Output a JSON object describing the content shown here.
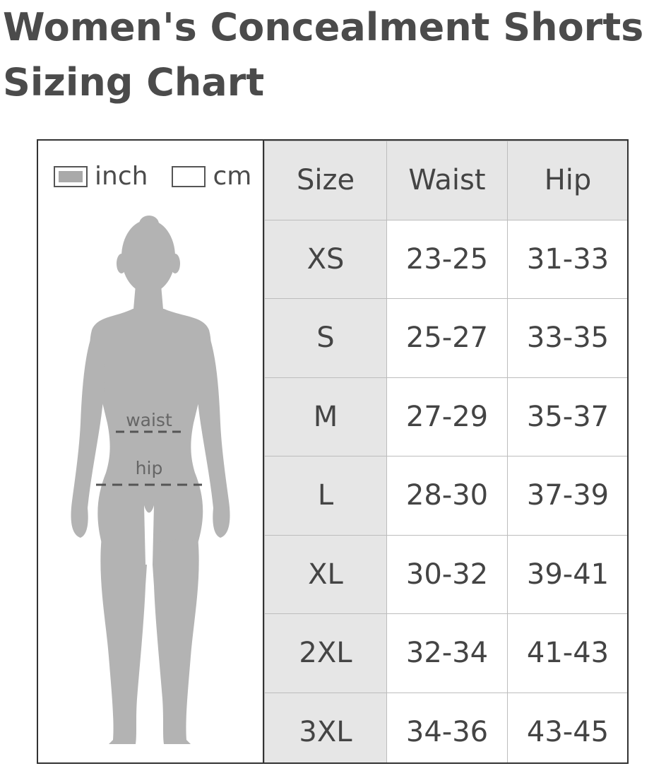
{
  "title": {
    "line1": "Women's Concealment Shorts",
    "line2": "Sizing Chart"
  },
  "legend": {
    "inch_label": "inch",
    "cm_label": "cm",
    "inch_color": "#a9a9a9"
  },
  "figure": {
    "waist_label": "waist",
    "hip_label": "hip",
    "body_color": "#b3b3b3"
  },
  "table": {
    "headers": [
      "Size",
      "Waist",
      "Hip"
    ],
    "rows": [
      {
        "size": "XS",
        "waist": "23-25",
        "hip": "31-33"
      },
      {
        "size": "S",
        "waist": "25-27",
        "hip": "33-35"
      },
      {
        "size": "M",
        "waist": "27-29",
        "hip": "35-37"
      },
      {
        "size": "L",
        "waist": "28-30",
        "hip": "37-39"
      },
      {
        "size": "XL",
        "waist": "30-32",
        "hip": "39-41"
      },
      {
        "size": "2XL",
        "waist": "32-34",
        "hip": "41-43"
      },
      {
        "size": "3XL",
        "waist": "34-36",
        "hip": "43-45"
      }
    ]
  }
}
